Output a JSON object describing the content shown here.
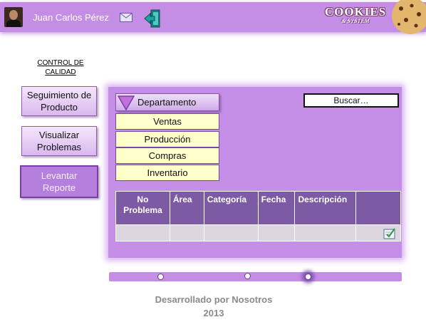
{
  "header": {
    "user_name": "Juan Carlos Pérez",
    "logo_main": "COOKIES",
    "logo_tag": "& SYSTEM",
    "mail_icon": "envelope-icon",
    "logout_icon": "exit-door-icon"
  },
  "sidebar": {
    "title_line1": "CONTROL DE",
    "title_line2": "CALIDAD",
    "items": [
      {
        "label_line1": "Seguimiento de",
        "label_line2": "Producto"
      },
      {
        "label_line1": "Visualizar",
        "label_line2": "Problemas"
      },
      {
        "label_line1": "Levantar",
        "label_line2": "Reporte",
        "active": true
      }
    ]
  },
  "main": {
    "dropdown_label": "Departamento",
    "dropdown_options": [
      "Ventas",
      "Producción",
      "Compras",
      "Inventario"
    ],
    "search_label": "Buscar…",
    "table": {
      "headers": [
        {
          "line1": "No",
          "line2": "Problema"
        },
        {
          "line1": "Área",
          "line2": ""
        },
        {
          "line1": "Categoría",
          "line2": ""
        },
        {
          "line1": "Fecha",
          "line2": ""
        },
        {
          "line1": "Descripción",
          "line2": ""
        },
        {
          "line1": "",
          "line2": ""
        }
      ],
      "rows": [
        [
          "",
          "",
          "",
          "",
          "",
          "edit-check-icon"
        ]
      ]
    }
  },
  "slider": {
    "stops": 3,
    "active_index": 2
  },
  "footer": {
    "line1": "Desarrollado por Nosotros",
    "line2": "2013"
  },
  "colors": {
    "accent": "#c58ee6",
    "table_header": "#7d5aa4",
    "option_bg": "#ffffcc"
  }
}
